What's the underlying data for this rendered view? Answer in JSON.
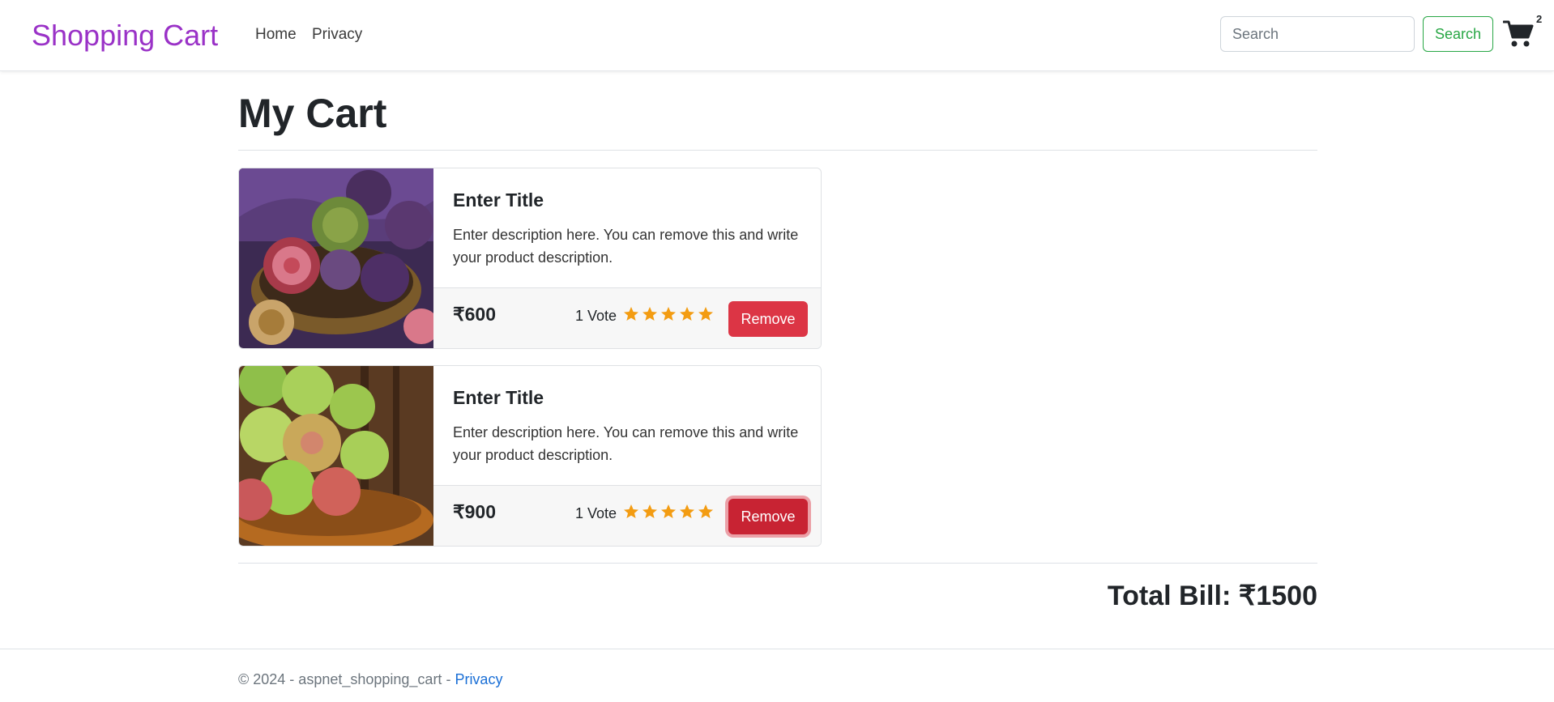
{
  "navbar": {
    "brand": "Shopping Cart",
    "links": [
      {
        "label": "Home"
      },
      {
        "label": "Privacy"
      }
    ],
    "search_placeholder": "Search",
    "search_button": "Search",
    "cart_count": "2",
    "cart_icon": "shopping-cart-icon"
  },
  "page": {
    "title": "My Cart"
  },
  "cart_items": [
    {
      "image": "figs-in-bowl",
      "title": "Enter Title",
      "description": "Enter description here. You can remove this and write your product description.",
      "price": "₹600",
      "votes": "1 Vote",
      "rating": 5,
      "remove_label": "Remove"
    },
    {
      "image": "green-apples-in-basket",
      "title": "Enter Title",
      "description": "Enter description here. You can remove this and write your product description.",
      "price": "₹900",
      "votes": "1 Vote",
      "rating": 5,
      "remove_label": "Remove"
    }
  ],
  "total": {
    "label": "Total Bill: ₹1500"
  },
  "footer": {
    "text": "© 2024 - aspnet_shopping_cart - ",
    "privacy_link": "Privacy"
  },
  "colors": {
    "brand": "#9a32c7",
    "danger": "#dc3545",
    "success": "#28a745",
    "star": "#f39c12",
    "link": "#1a6fd6"
  }
}
